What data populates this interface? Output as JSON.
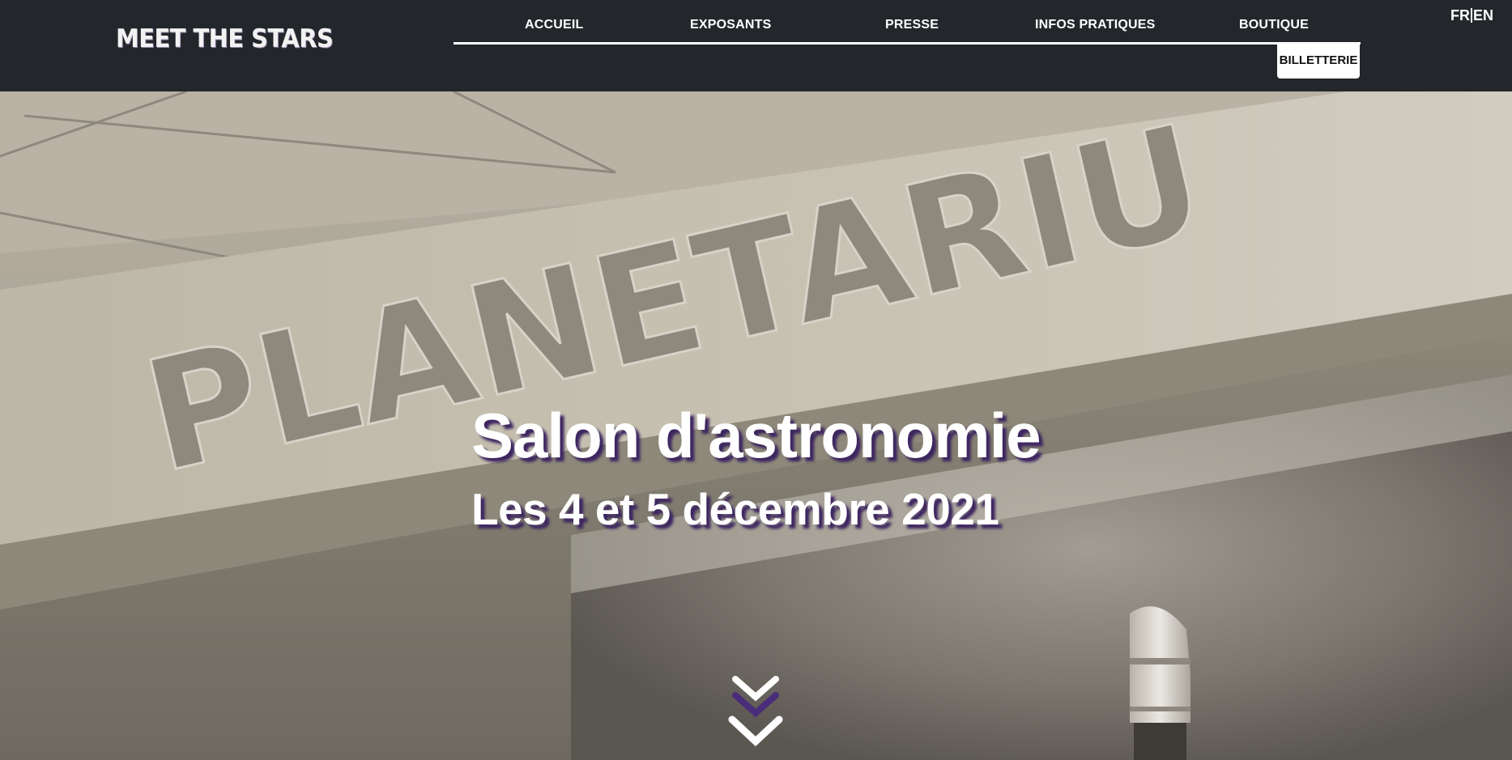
{
  "header": {
    "logo_text": "MEET THE STARS",
    "nav": [
      {
        "label": "ACCUEIL"
      },
      {
        "label": "EXPOSANTS"
      },
      {
        "label": "PRESSE"
      },
      {
        "label": "INFOS PRATIQUES"
      },
      {
        "label": "BOUTIQUE"
      }
    ],
    "ticket_label": "BILLETTERIE",
    "lang": {
      "fr": "FR",
      "en": "EN"
    }
  },
  "hero": {
    "background_sign_text": "PLANETARIU",
    "title": "Salon d'astronomie",
    "subtitle": "Les 4 et 5 décembre 2021",
    "scroll_icon": "double-chevron-down-icon"
  },
  "colors": {
    "header_bg": "#23272b",
    "text_shadow_purple": "#3d2660",
    "accent_purple": "#4a2d7a"
  }
}
